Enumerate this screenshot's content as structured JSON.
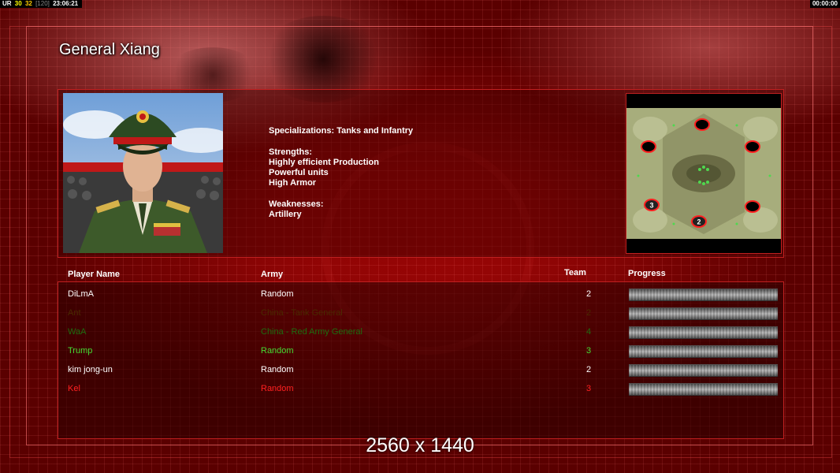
{
  "topbar": {
    "ur": "UR",
    "fps": "30",
    "fps2": "32",
    "bracket": "[120]",
    "clock": "23:06:21",
    "timer": "00:00:00"
  },
  "general": {
    "name": "General Xiang",
    "specs": [
      "Specializations: Tanks and Infantry",
      "",
      "Strengths:",
      "Highly efficient Production",
      "Powerful units",
      "High Armor",
      "",
      "Weaknesses:",
      "Artillery"
    ]
  },
  "minimap": {
    "slot_labels": [
      "3",
      "2"
    ]
  },
  "table": {
    "headers": {
      "player": "Player Name",
      "army": "Army",
      "team": "Team",
      "progress": "Progress"
    },
    "rows": [
      {
        "name": "DiLmA",
        "army": "Random",
        "team": "2",
        "color": "#ffffff",
        "progress": 1.0
      },
      {
        "name": "Ant",
        "army": "China - Tank General",
        "team": "2",
        "color": "#4a2a00",
        "progress": 1.0
      },
      {
        "name": "WaA",
        "army": "China - Red Army General",
        "team": "4",
        "color": "#1d6e10",
        "progress": 1.0
      },
      {
        "name": "Trump",
        "army": "Random",
        "team": "3",
        "color": "#44dd33",
        "progress": 1.0
      },
      {
        "name": "kim jong-un",
        "army": "Random",
        "team": "2",
        "color": "#ffffff",
        "progress": 1.0
      },
      {
        "name": "Kel",
        "army": "Random",
        "team": "3",
        "color": "#ff2020",
        "progress": 1.0
      }
    ]
  },
  "resolution_label": "2560 x 1440",
  "colors": {
    "accent": "#c02020",
    "background": "#b00808"
  }
}
